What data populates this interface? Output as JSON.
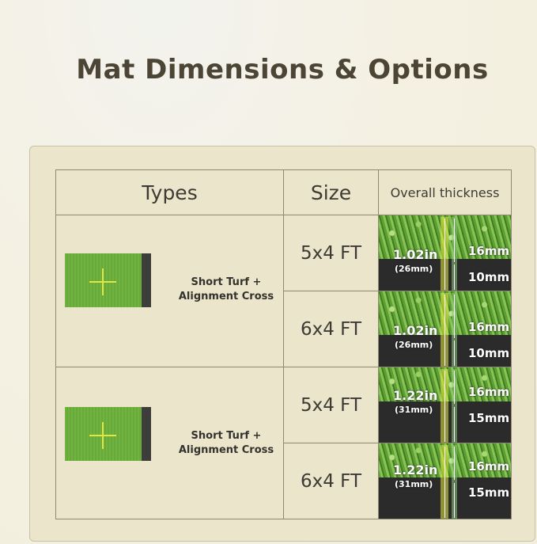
{
  "title": "Mat Dimensions & Options",
  "headers": {
    "types": "Types",
    "size": "Size",
    "thickness": "Overall thickness"
  },
  "colors": {
    "turf": "#6ab03a",
    "base": "#2a2b2a",
    "cross": "#e3e640",
    "title": "#4c4434"
  },
  "groups": [
    {
      "mat_label": "Short Turf + Alignment Cross",
      "rows": [
        {
          "size": "5x4 FT",
          "total": "1.02in",
          "total_mm": "(26mm)",
          "turf": "16mm",
          "base": "10mm"
        },
        {
          "size": "6x4 FT",
          "total": "1.02in",
          "total_mm": "(26mm)",
          "turf": "16mm",
          "base": "10mm"
        }
      ]
    },
    {
      "mat_label": "Short Turf + Alignment Cross",
      "rows": [
        {
          "size": "5x4 FT",
          "total": "1.22in",
          "total_mm": "(31mm)",
          "turf": "16mm",
          "base": "15mm"
        },
        {
          "size": "6x4 FT",
          "total": "1.22in",
          "total_mm": "(31mm)",
          "turf": "16mm",
          "base": "15mm"
        }
      ]
    }
  ]
}
